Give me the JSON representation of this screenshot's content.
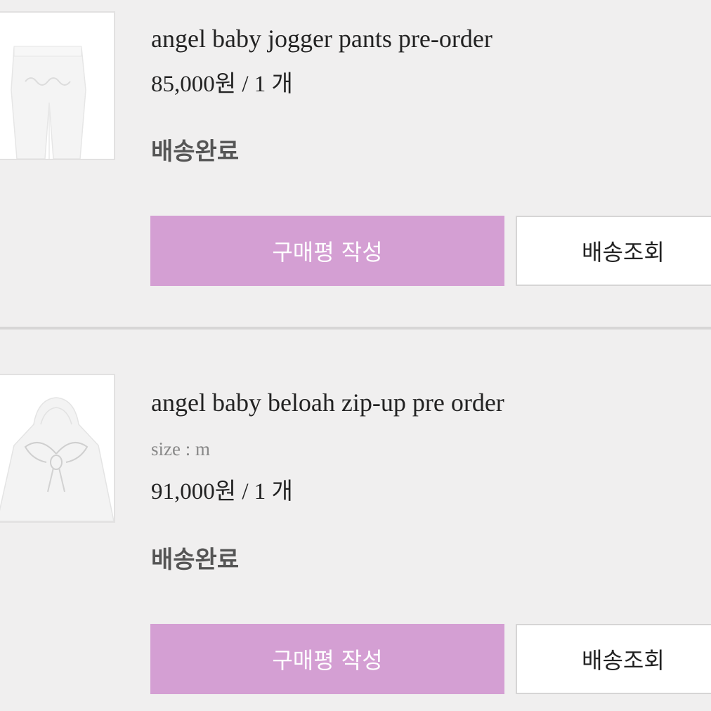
{
  "colors": {
    "background": "#f0efef",
    "review_button": "#d49fd3",
    "track_button": "#ffffff",
    "status_text": "#555555"
  },
  "orders": [
    {
      "thumbnail_icon": "jogger-pants-image",
      "title": "angel baby jogger pants pre-order",
      "price": "85,000원 / 1 개",
      "status": "배송완료",
      "review_label": "구매평 작성",
      "track_label": "배송조회"
    },
    {
      "thumbnail_icon": "zip-up-hoodie-image",
      "title": "angel baby beloah zip-up pre order",
      "option": "size : m",
      "price": "91,000원 / 1 개",
      "status": "배송완료",
      "review_label": "구매평 작성",
      "track_label": "배송조회"
    }
  ]
}
